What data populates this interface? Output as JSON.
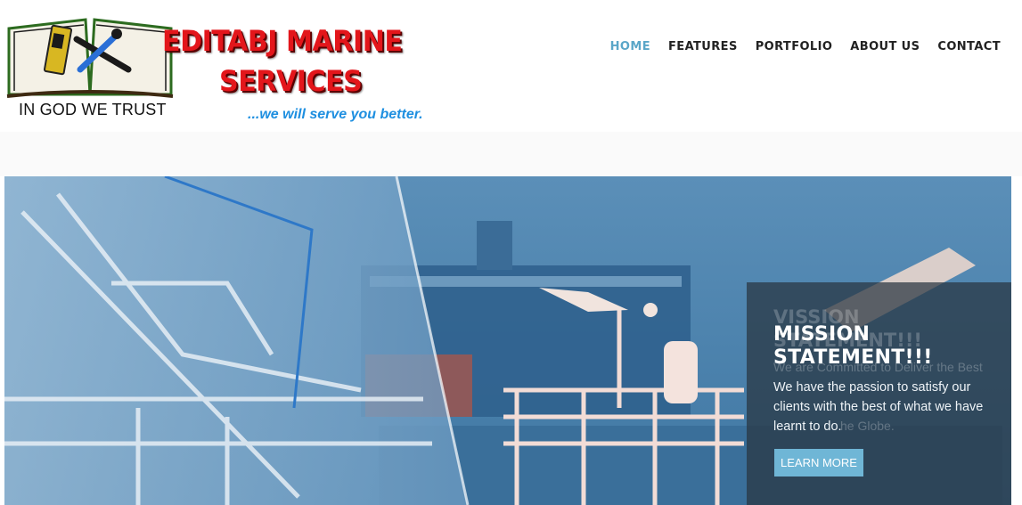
{
  "brand": {
    "name_line1": "EDITABJ MARINE",
    "name_line2": "SERVICES",
    "tagline": "...we will serve you better.",
    "motto": "IN GOD WE TRUST"
  },
  "nav": {
    "items": [
      {
        "label": "HOME",
        "active": true
      },
      {
        "label": "FEATURES",
        "active": false
      },
      {
        "label": "PORTFOLIO",
        "active": false
      },
      {
        "label": "ABOUT US",
        "active": false
      },
      {
        "label": "CONTACT",
        "active": false
      }
    ]
  },
  "hero": {
    "ghost_title": "VISSION STATEMENT!!!",
    "ghost_text_start": "We are Committed to Deliver the Best",
    "ghost_text_end": "he Globe.",
    "title": "MISSION STATEMENT!!!",
    "text": "We have the passion to satisfy our clients with the best of what we have learnt to do.",
    "button_label": "LEARN MORE"
  },
  "colors": {
    "brand_red": "#e3161b",
    "tagline_blue": "#1e8fe0",
    "nav_active": "#5aa6c8",
    "button_bg": "#6fb6d6"
  }
}
